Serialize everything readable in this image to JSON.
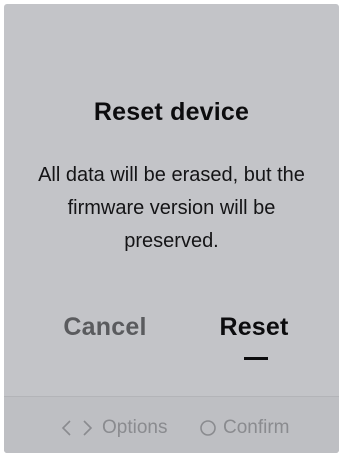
{
  "dialog": {
    "title": "Reset device",
    "message": "All data will be erased, but the firmware version will be preserved.",
    "cancel_label": "Cancel",
    "reset_label": "Reset",
    "selected": "Reset"
  },
  "footer": {
    "options_label": "Options",
    "options_icon": "left-right-chevron-icon",
    "confirm_label": "Confirm",
    "confirm_icon": "circle-icon"
  },
  "colors": {
    "background": "#c3c4c8",
    "text_primary": "#0c0c0e",
    "text_muted": "#5a5b5e",
    "footer_text": "#8a8b8f"
  }
}
